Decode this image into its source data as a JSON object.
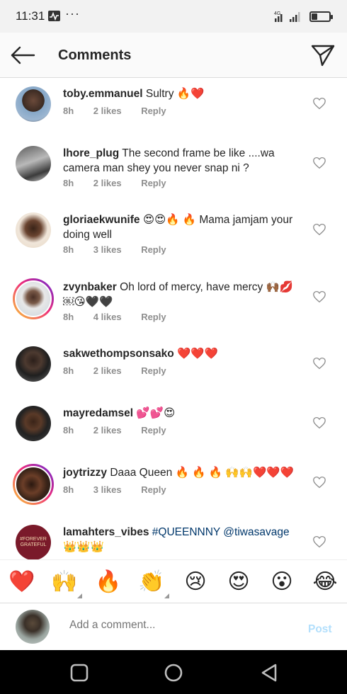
{
  "status_bar": {
    "time": "11:31",
    "dots": "···",
    "network": "4G"
  },
  "header": {
    "title": "Comments",
    "back_icon": "arrow-left-icon",
    "share_icon": "paper-plane-icon"
  },
  "comments": [
    {
      "username": "toby.emmanuel",
      "text": " Sultry 🔥❤️",
      "time": "8h",
      "likes": "2 likes",
      "reply": "Reply",
      "story_ring": false
    },
    {
      "username": "lhore_plug",
      "text": " The second frame be like ....wa camera man shey you never snap ni ?",
      "time": "8h",
      "likes": "2 likes",
      "reply": "Reply",
      "story_ring": false
    },
    {
      "username": "gloriaekwunife",
      "text": " 😍😍🔥 🔥 Mama jamjam your doing well",
      "time": "8h",
      "likes": "3 likes",
      "reply": "Reply",
      "story_ring": false
    },
    {
      "username": "zvynbaker",
      "text": " Oh lord of mercy, have mercy 🙌🏾💋 ￼😘🖤🖤",
      "time": "8h",
      "likes": "4 likes",
      "reply": "Reply",
      "story_ring": true
    },
    {
      "username": "sakwethompsonsako",
      "text": " ❤️❤️❤️",
      "time": "8h",
      "likes": "2 likes",
      "reply": "Reply",
      "story_ring": false
    },
    {
      "username": "mayredamsel",
      "text": " 💕💕😍",
      "time": "8h",
      "likes": "2 likes",
      "reply": "Reply",
      "story_ring": false
    },
    {
      "username": "joytrizzy",
      "text": " Daaa Queen 🔥 🔥 🔥 🙌🙌❤️❤️❤️",
      "time": "8h",
      "likes": "3 likes",
      "reply": "Reply",
      "story_ring": true
    },
    {
      "username": "lamahters_vibes",
      "text_highlight": " #QUEENNNY @tiwasavage",
      "text_after": " 👑👑👑",
      "story_ring": false
    }
  ],
  "avatar_last_text": "#FOREVER GRATEFUL",
  "emoji_bar": [
    "❤️",
    "🙌",
    "🔥",
    "👏",
    "😢",
    "😍",
    "😮",
    "😂"
  ],
  "composer": {
    "placeholder": "Add a comment...",
    "post_label": "Post"
  },
  "colors": {
    "username": "#262626",
    "meta": "#8e8e8e",
    "post_disabled": "#b2dffc",
    "link": "#00376b"
  }
}
